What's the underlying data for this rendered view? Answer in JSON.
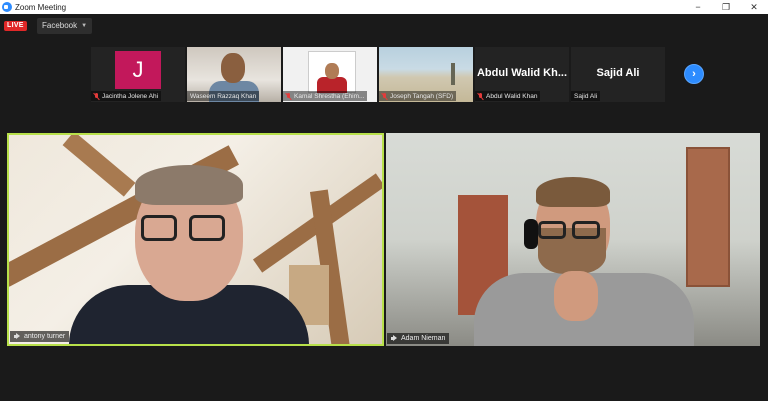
{
  "window": {
    "title": "Zoom Meeting",
    "controls": {
      "minimize": "−",
      "restore": "❐",
      "close": "✕"
    }
  },
  "livebar": {
    "live_label": "LIVE",
    "stream_label": "Facebook"
  },
  "gallery": {
    "participants": [
      {
        "name": "Jacintha Jolene Ahi",
        "avatar_letter": "J",
        "muted": true,
        "video": false,
        "avatar_color": "#c2185b"
      },
      {
        "name": "Waseem Razzaq Khan",
        "muted": false,
        "video": true
      },
      {
        "name": "Kamal Shrestha (Ehim...",
        "muted": true,
        "video": true
      },
      {
        "name": "Joseph Tangah (SFD)",
        "muted": true,
        "video": true
      },
      {
        "name": "Abdul Walid Khan",
        "display_name": "Abdul Walid Kh...",
        "muted": true,
        "video": false
      },
      {
        "name": "Sajid Ali",
        "display_name": "Sajid Ali",
        "muted": false,
        "video": false
      }
    ],
    "next_icon": "›"
  },
  "main": {
    "speaker_left": {
      "name": "antony turner",
      "active": true,
      "highlight_color": "#b8e04a"
    },
    "speaker_right": {
      "name": "Adam Nieman",
      "active": false
    }
  },
  "colors": {
    "accent": "#2d8cff",
    "live": "#e02828",
    "active_speaker": "#b8e04a",
    "background": "#1a1a1a"
  }
}
